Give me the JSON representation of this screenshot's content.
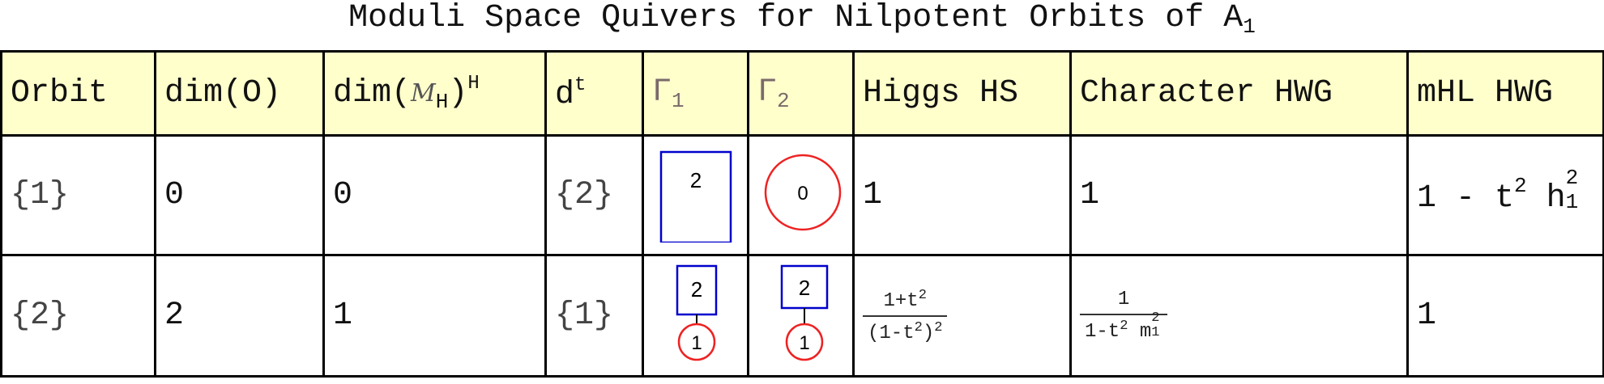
{
  "title": {
    "text": "Moduli Space Quivers for Nilpotent Orbits of A",
    "subscript": "1"
  },
  "headers": {
    "orbit": "Orbit",
    "dim_o": "dim(O)",
    "dim_mh": "dim(",
    "dim_mh_sym": "M",
    "dim_mh_sub": "H",
    "dim_mh_close": ")",
    "dim_mh_sup": "H",
    "dt": "d",
    "dt_sup": "t",
    "gamma1": "Γ",
    "gamma1_sub": "1",
    "gamma2": "Γ",
    "gamma2_sub": "2",
    "higgs": "Higgs HS",
    "character": "Character HWG",
    "mhl": "mHL HWG"
  },
  "rows": [
    {
      "orbit": "{1}",
      "dim_o": "0",
      "dim_mh": "0",
      "dt": "{2}",
      "gamma1": {
        "square": "2"
      },
      "gamma2": {
        "circle": "0"
      },
      "higgs": "1",
      "character": "1",
      "mhl": {
        "a": "1 - t",
        "a_sup": "2",
        "b": " h",
        "b_sub": "1",
        "b_sup": "2"
      }
    },
    {
      "orbit": "{2}",
      "dim_o": "2",
      "dim_mh": "1",
      "dt": "{1}",
      "gamma1": {
        "square": "2",
        "circle": "1"
      },
      "gamma2": {
        "square": "2",
        "circle": "1"
      },
      "higgs": {
        "num": "1+t",
        "num_sup": "2",
        "den": "(1-t",
        "den_sup": "2",
        "den_close": ")",
        "den_close_sup": "2"
      },
      "character": {
        "num": "1",
        "den": "1-t",
        "den_sup": "2",
        "den_m": " m",
        "den_m_sub": "1",
        "den_m_sup": "2"
      },
      "mhl": "1"
    }
  ],
  "colors": {
    "header_bg": "#ffffcc",
    "square": "#0000cc",
    "circle": "#ee2222",
    "border": "#000000"
  }
}
